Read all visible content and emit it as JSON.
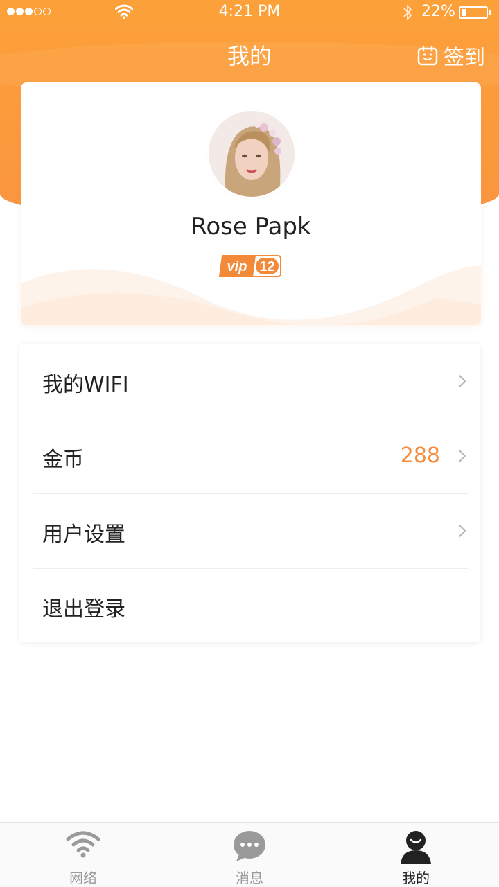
{
  "status_bar": {
    "time": "4:21 PM",
    "battery_percent": "22%",
    "battery_level": 0.22,
    "signal_dots_filled": 3,
    "signal_dots_total": 5
  },
  "nav": {
    "title": "我的",
    "checkin_label": "签到",
    "checkin_icon": "calendar-smile-icon"
  },
  "profile": {
    "username": "Rose Papk",
    "vip_label": "vip",
    "vip_level": "12"
  },
  "menu": {
    "items": [
      {
        "label": "我的WIFI",
        "value": "",
        "chevron": true
      },
      {
        "label": "金币",
        "value": "288",
        "chevron": true
      },
      {
        "label": "用户设置",
        "value": "",
        "chevron": true
      },
      {
        "label": "退出登录",
        "value": "",
        "chevron": false
      }
    ]
  },
  "tab_bar": {
    "tabs": [
      {
        "label": "网络",
        "icon": "wifi-icon",
        "active": false
      },
      {
        "label": "消息",
        "icon": "chat-bubble-icon",
        "active": false
      },
      {
        "label": "我的",
        "icon": "user-icon",
        "active": true
      }
    ]
  },
  "colors": {
    "accent": "#f99a3d",
    "value_text": "#f58a3b",
    "tab_inactive": "#9a9a9a",
    "tab_active": "#222222"
  }
}
